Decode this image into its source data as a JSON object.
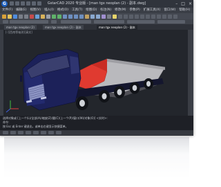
{
  "app": {
    "title": "GstarCAD 2020 专业版 - [man tgx neoplan (2) - 副本.dwg]",
    "logo_letter": "G",
    "window_controls": [
      "–",
      "□",
      "×"
    ]
  },
  "menu": [
    "文件(F)",
    "编辑(E)",
    "视图(V)",
    "插入(I)",
    "格式(O)",
    "工具(T)",
    "绘图(D)",
    "标注(N)",
    "修改(M)",
    "参数(P)",
    "扩展工具(X)",
    "窗口(W)",
    "帮助(H)"
  ],
  "tabs": [
    {
      "label": "man tgx neoplan (2)"
    },
    {
      "label": "man tgx neoplan (2) - 副本"
    },
    {
      "label": "man tgx neoplan (2) - 副本",
      "active": true
    }
  ],
  "viewport": {
    "label": "[-][西南等轴测][真实]"
  },
  "command_lines": [
    "选择对象或 [上一个(L)/全部(A)/缩放(Z)/圆(C)/上一个(P)/窗口(W)/对象(O)] <实时>:",
    "命令: ",
    "按 Esc 或 Enter 键退出，或单击右键显示快捷菜单。"
  ],
  "colors": {
    "truck_cab": "#1c2159",
    "truck_red": "#e03a30",
    "deck": "#b9b9bd",
    "background": "#23262c"
  }
}
